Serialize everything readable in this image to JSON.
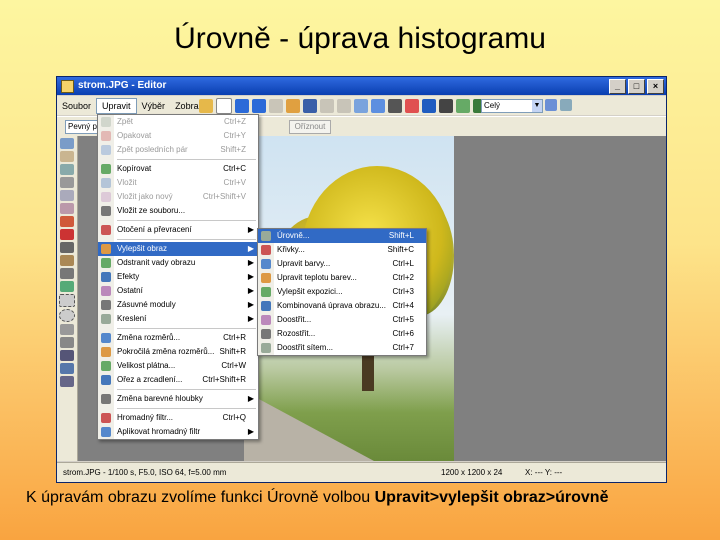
{
  "slide": {
    "title": "Úrovně - úprava histogramu",
    "caption_plain": "K úpravám obrazu zvolíme funkci Úrovně volbou ",
    "caption_bold": "Upravit>vylepšit obraz>úrovně"
  },
  "window": {
    "title": "strom.JPG - Editor",
    "buttons": [
      "_",
      "□",
      "×"
    ]
  },
  "menubar": [
    "Soubor",
    "Upravit",
    "Výběr",
    "Zobrazit"
  ],
  "toolbar": {
    "combo_value": "Celý",
    "field_value": "Pevný po",
    "disabled_button": "Oříznout"
  },
  "status": {
    "file_info": "strom.JPG - 1/100 s, F5.0, ISO 64, f=5.00 mm",
    "dims": "1200 x 1200 x 24",
    "coords": "X: --- Y: ---"
  },
  "edit_menu": [
    {
      "label": "Zpět",
      "shortcut": "Ctrl+Z",
      "disabled": true
    },
    {
      "label": "Opakovat",
      "shortcut": "Ctrl+Y",
      "disabled": true
    },
    {
      "label": "Zpět posledních pár",
      "shortcut": "Shift+Z",
      "disabled": true
    },
    {
      "sep": true
    },
    {
      "label": "Kopírovat",
      "shortcut": "Ctrl+C"
    },
    {
      "label": "Vložit",
      "shortcut": "Ctrl+V",
      "disabled": true
    },
    {
      "label": "Vložit jako nový",
      "shortcut": "Ctrl+Shift+V",
      "disabled": true
    },
    {
      "label": "Vložit ze souboru...",
      "shortcut": ""
    },
    {
      "sep": true
    },
    {
      "label": "Otočení a převracení",
      "arrow": true
    },
    {
      "sep": true
    },
    {
      "label": "Vylepšit obraz",
      "arrow": true,
      "highlight": true
    },
    {
      "label": "Odstranit vady obrazu",
      "arrow": true
    },
    {
      "label": "Efekty",
      "arrow": true
    },
    {
      "label": "Ostatní",
      "arrow": true
    },
    {
      "label": "Zásuvné moduly",
      "arrow": true
    },
    {
      "label": "Kreslení",
      "arrow": true
    },
    {
      "sep": true
    },
    {
      "label": "Změna rozměrů...",
      "shortcut": "Ctrl+R"
    },
    {
      "label": "Pokročilá změna rozměrů...",
      "shortcut": "Shift+R"
    },
    {
      "label": "Velikost plátna...",
      "shortcut": "Ctrl+W"
    },
    {
      "label": "Ořez a zrcadlení...",
      "shortcut": "Ctrl+Shift+R"
    },
    {
      "sep": true
    },
    {
      "label": "Změna barevné hloubky",
      "arrow": true
    },
    {
      "sep": true
    },
    {
      "label": "Hromadný filtr...",
      "shortcut": "Ctrl+Q"
    },
    {
      "label": "Aplikovat hromadný filtr",
      "arrow": true
    }
  ],
  "enhance_menu": [
    {
      "label": "Úrovně...",
      "shortcut": "Shift+L",
      "highlight": true
    },
    {
      "label": "Křivky...",
      "shortcut": "Shift+C"
    },
    {
      "label": "Upravit barvy...",
      "shortcut": "Ctrl+L"
    },
    {
      "label": "Upravit teplotu barev...",
      "shortcut": "Ctrl+2"
    },
    {
      "label": "Vylepšit expozici...",
      "shortcut": "Ctrl+3"
    },
    {
      "label": "Kombinovaná úprava obrazu...",
      "shortcut": "Ctrl+4"
    },
    {
      "label": "Doostřit...",
      "shortcut": "Ctrl+5"
    },
    {
      "label": "Rozostřit...",
      "shortcut": "Ctrl+6"
    },
    {
      "label": "Doostřit sítem...",
      "shortcut": "Ctrl+7"
    }
  ],
  "colors": {
    "titlebar": "#0a3fb0",
    "highlight": "#316ac5"
  }
}
